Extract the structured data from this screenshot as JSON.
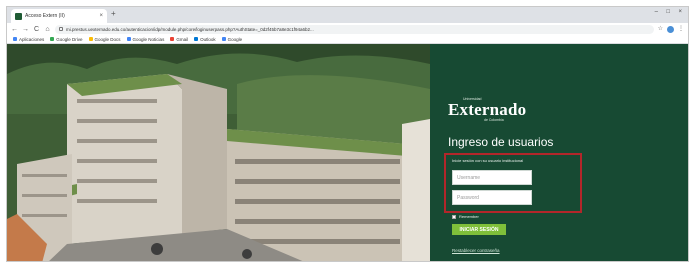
{
  "browser": {
    "tab": {
      "title": "Acceso Extern (II)",
      "close_glyph": "×"
    },
    "new_tab_glyph": "+",
    "window_controls": {
      "minimize": "–",
      "maximize": "□",
      "close": "×"
    },
    "toolbar": {
      "back": "←",
      "forward": "→",
      "reload": "C",
      "home": "⌂",
      "url": "mi.prestus.uexternado.edu.co/autenticacion/idp/module.php/core/loginuserpass.php?AuthState=_0d2f45b7a8e3c1f94a6b2...",
      "star_glyph": "☆",
      "menu_glyph": "⋮"
    },
    "bookmarks": [
      {
        "label": "Aplicaciones",
        "color": "#4285f4"
      },
      {
        "label": "Google Drive",
        "color": "#34a853"
      },
      {
        "label": "Google Docs",
        "color": "#fbbc05"
      },
      {
        "label": "Google Noticias",
        "color": "#4285f4"
      },
      {
        "label": "Gmail",
        "color": "#ea4335"
      },
      {
        "label": "Outlook",
        "color": "#0078d4"
      },
      {
        "label": "Google",
        "color": "#4285f4"
      }
    ]
  },
  "login": {
    "logo_small_top": "Universidad",
    "logo": "Externado",
    "logo_small_bottom": "de Colombia",
    "title": "Ingreso de usuarios",
    "instructions": "Inicie sesión con su usuario institucional",
    "username_placeholder": "Username",
    "password_placeholder": "Password",
    "remember_label": "Remember",
    "login_button": "INICIAR SESIÓN",
    "forgot_link": "Restablecer contraseña"
  },
  "colors": {
    "panel_bg": "#174a33",
    "button_bg": "#7fbf3a",
    "highlight_border": "#b3262a"
  }
}
